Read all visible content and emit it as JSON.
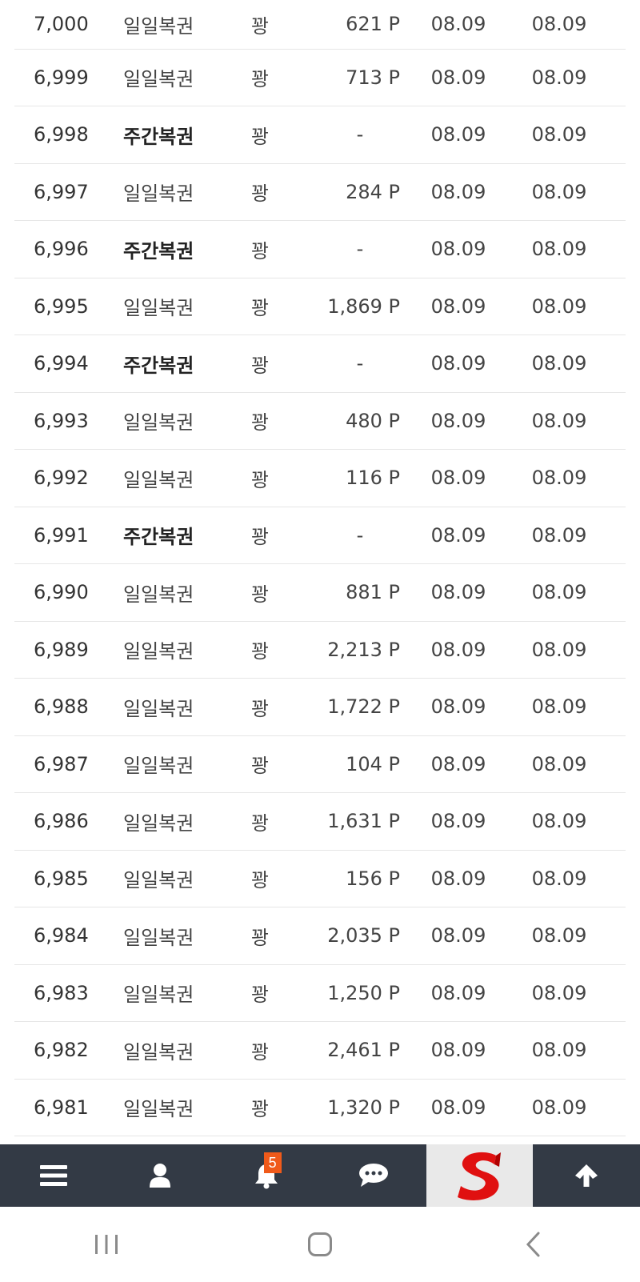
{
  "rows": [
    {
      "no": "7,000",
      "type": "일일복권",
      "bold": false,
      "status": "꽝",
      "point": "621 P",
      "date1": "08.09",
      "date2": "08.09"
    },
    {
      "no": "6,999",
      "type": "일일복권",
      "bold": false,
      "status": "꽝",
      "point": "713 P",
      "date1": "08.09",
      "date2": "08.09"
    },
    {
      "no": "6,998",
      "type": "주간복권",
      "bold": true,
      "status": "꽝",
      "point": "-",
      "date1": "08.09",
      "date2": "08.09"
    },
    {
      "no": "6,997",
      "type": "일일복권",
      "bold": false,
      "status": "꽝",
      "point": "284 P",
      "date1": "08.09",
      "date2": "08.09"
    },
    {
      "no": "6,996",
      "type": "주간복권",
      "bold": true,
      "status": "꽝",
      "point": "-",
      "date1": "08.09",
      "date2": "08.09"
    },
    {
      "no": "6,995",
      "type": "일일복권",
      "bold": false,
      "status": "꽝",
      "point": "1,869 P",
      "date1": "08.09",
      "date2": "08.09"
    },
    {
      "no": "6,994",
      "type": "주간복권",
      "bold": true,
      "status": "꽝",
      "point": "-",
      "date1": "08.09",
      "date2": "08.09"
    },
    {
      "no": "6,993",
      "type": "일일복권",
      "bold": false,
      "status": "꽝",
      "point": "480 P",
      "date1": "08.09",
      "date2": "08.09"
    },
    {
      "no": "6,992",
      "type": "일일복권",
      "bold": false,
      "status": "꽝",
      "point": "116 P",
      "date1": "08.09",
      "date2": "08.09"
    },
    {
      "no": "6,991",
      "type": "주간복권",
      "bold": true,
      "status": "꽝",
      "point": "-",
      "date1": "08.09",
      "date2": "08.09"
    },
    {
      "no": "6,990",
      "type": "일일복권",
      "bold": false,
      "status": "꽝",
      "point": "881 P",
      "date1": "08.09",
      "date2": "08.09"
    },
    {
      "no": "6,989",
      "type": "일일복권",
      "bold": false,
      "status": "꽝",
      "point": "2,213 P",
      "date1": "08.09",
      "date2": "08.09"
    },
    {
      "no": "6,988",
      "type": "일일복권",
      "bold": false,
      "status": "꽝",
      "point": "1,722 P",
      "date1": "08.09",
      "date2": "08.09"
    },
    {
      "no": "6,987",
      "type": "일일복권",
      "bold": false,
      "status": "꽝",
      "point": "104 P",
      "date1": "08.09",
      "date2": "08.09"
    },
    {
      "no": "6,986",
      "type": "일일복권",
      "bold": false,
      "status": "꽝",
      "point": "1,631 P",
      "date1": "08.09",
      "date2": "08.09"
    },
    {
      "no": "6,985",
      "type": "일일복권",
      "bold": false,
      "status": "꽝",
      "point": "156 P",
      "date1": "08.09",
      "date2": "08.09"
    },
    {
      "no": "6,984",
      "type": "일일복권",
      "bold": false,
      "status": "꽝",
      "point": "2,035 P",
      "date1": "08.09",
      "date2": "08.09"
    },
    {
      "no": "6,983",
      "type": "일일복권",
      "bold": false,
      "status": "꽝",
      "point": "1,250 P",
      "date1": "08.09",
      "date2": "08.09"
    },
    {
      "no": "6,982",
      "type": "일일복권",
      "bold": false,
      "status": "꽝",
      "point": "2,461 P",
      "date1": "08.09",
      "date2": "08.09"
    },
    {
      "no": "6,981",
      "type": "일일복권",
      "bold": false,
      "status": "꽝",
      "point": "1,320 P",
      "date1": "08.09",
      "date2": "08.09"
    }
  ],
  "bottom_bar": {
    "items": [
      {
        "name": "menu-icon"
      },
      {
        "name": "user-icon"
      },
      {
        "name": "bell-icon",
        "badge": "5"
      },
      {
        "name": "chat-icon"
      },
      {
        "name": "site-logo"
      },
      {
        "name": "arrow-up-icon"
      }
    ],
    "colors": {
      "bar": "#333a45",
      "badge": "#f05a1a",
      "logo_bg": "#e9e9e9",
      "logo_red": "#e01010"
    }
  },
  "system_nav": {
    "items": [
      {
        "name": "recent-apps-icon"
      },
      {
        "name": "home-icon"
      },
      {
        "name": "back-icon"
      }
    ]
  }
}
